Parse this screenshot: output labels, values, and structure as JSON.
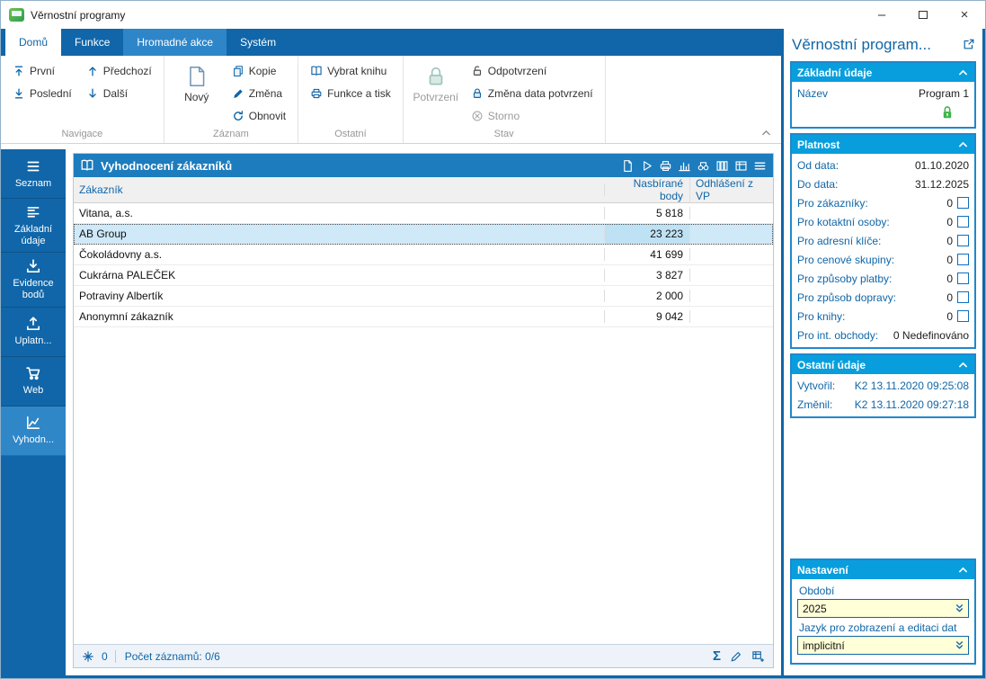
{
  "window": {
    "title": "Věrnostní programy",
    "minimize_glyph": "–",
    "close_glyph": "×"
  },
  "tabs": [
    {
      "label": "Domů",
      "active": true
    },
    {
      "label": "Funkce",
      "active": false
    },
    {
      "label": "Hromadné akce",
      "active": false,
      "highlighted": true
    },
    {
      "label": "Systém",
      "active": false
    }
  ],
  "ribbon": {
    "navigace": {
      "label": "Navigace",
      "first": "První",
      "prev": "Předchozí",
      "last": "Poslední",
      "next": "Další"
    },
    "zaznam": {
      "label": "Záznam",
      "new": "Nový",
      "copy": "Kopie",
      "change": "Změna",
      "refresh": "Obnovit"
    },
    "ostatni": {
      "label": "Ostatní",
      "select_book": "Vybrat knihu",
      "functions_print": "Funkce a tisk"
    },
    "stav": {
      "label": "Stav",
      "confirm": "Potvrzení",
      "unconfirm": "Odpotvrzení",
      "change_confirm_date": "Změna data potvrzení",
      "storno": "Storno"
    }
  },
  "sidebar": [
    {
      "label": "Seznam",
      "icon": "list-icon",
      "active": false
    },
    {
      "label": "Základní údaje",
      "icon": "detail-list-icon",
      "active": false
    },
    {
      "label": "Evidence bodů",
      "icon": "points-in-icon",
      "active": false
    },
    {
      "label": "Uplatn...",
      "icon": "points-out-icon",
      "active": false
    },
    {
      "label": "Web",
      "icon": "cart-icon",
      "active": false
    },
    {
      "label": "Vyhodn...",
      "icon": "line-chart-icon",
      "active": true
    }
  ],
  "main": {
    "title": "Vyhodnocení zákazníků",
    "columns": {
      "customer": "Zákazník",
      "points": "Nasbírané body",
      "optout": "Odhlášení z VP"
    },
    "selected_row_index": 1,
    "rows": [
      {
        "customer": "Vitana, a.s.",
        "points": "5 818",
        "optout": ""
      },
      {
        "customer": "AB Group",
        "points": "23 223",
        "optout": ""
      },
      {
        "customer": "Čokoládovny a.s.",
        "points": "41 699",
        "optout": ""
      },
      {
        "customer": "Cukrárna PALEČEK",
        "points": "3 827",
        "optout": ""
      },
      {
        "customer": "Potraviny Albertík",
        "points": "2 000",
        "optout": ""
      },
      {
        "customer": "Anonymní zákazník",
        "points": "9 042",
        "optout": ""
      }
    ],
    "status": {
      "flag_count": "0",
      "records": "Počet záznamů: 0/6",
      "sigma": "Σ"
    }
  },
  "panel": {
    "title": "Věrnostní program...",
    "zakladni": {
      "header": "Základní údaje",
      "nazev_label": "Název",
      "nazev_value": "Program 1"
    },
    "platnost": {
      "header": "Platnost",
      "rows": [
        {
          "label": "Od data:",
          "value": "01.10.2020",
          "checkbox": false
        },
        {
          "label": "Do data:",
          "value": "31.12.2025",
          "checkbox": false
        },
        {
          "label": "Pro zákazníky:",
          "value": "0",
          "checkbox": true
        },
        {
          "label": "Pro kotaktní osoby:",
          "value": "0",
          "checkbox": true
        },
        {
          "label": "Pro adresní klíče:",
          "value": "0",
          "checkbox": true
        },
        {
          "label": "Pro cenové skupiny:",
          "value": "0",
          "checkbox": true
        },
        {
          "label": "Pro způsoby platby:",
          "value": "0",
          "checkbox": true
        },
        {
          "label": "Pro způsob dopravy:",
          "value": "0",
          "checkbox": true
        },
        {
          "label": "Pro knihy:",
          "value": "0",
          "checkbox": true
        },
        {
          "label": "Pro int. obchody:",
          "value": "0 Nedefinováno",
          "checkbox": false
        }
      ]
    },
    "ostatni": {
      "header": "Ostatní údaje",
      "rows": [
        {
          "label": "Vytvořil:",
          "value": "K2 13.11.2020 09:25:08"
        },
        {
          "label": "Změnil:",
          "value": "K2 13.11.2020 09:27:18"
        }
      ]
    },
    "nastaveni": {
      "header": "Nastavení",
      "obdobi_label": "Období",
      "obdobi_value": "2025",
      "jazyk_label": "Jazyk pro zobrazení a editaci dat",
      "jazyk_value": "implicitní"
    }
  },
  "colors": {
    "dark_blue": "#1066a8",
    "tab_highlight": "#2e86c8",
    "panel_header_blue": "#1d7cbd",
    "section_header_blue": "#089edd",
    "selected_row": "#cfe9f9",
    "input_yellow": "#ffffd8",
    "green_lock": "#3db54a"
  },
  "icons": {
    "app-icon": "green-window-logo",
    "first-icon": "arrow-up-to-line",
    "prev-icon": "arrow-up",
    "last-icon": "arrow-down-to-line",
    "next-icon": "arrow-down",
    "new-record-icon": "blank-page",
    "copy-icon": "two-pages",
    "edit-icon": "pencil",
    "refresh-icon": "circular-arrow",
    "select-book-icon": "open-book",
    "print-icon": "printer",
    "confirm-lock-icon": "lock",
    "unconfirm-lock-icon": "open-lock",
    "change-date-lock-icon": "lock",
    "storno-icon": "crossed-circle",
    "panel-book-icon": "open-book",
    "run-icon": "play-triangle",
    "chart-icon": "bar-chart",
    "binoculars-icon": "binoculars",
    "columns-icon": "columns",
    "view-switch-icon": "grid",
    "menu-icon": "hamburger",
    "filter-flake-icon": "asterisk",
    "sum-icon": "sigma",
    "grid-copy-icon": "grid-plus",
    "external-link-icon": "box-arrow",
    "collapse-chevron-icon": "chevron-up",
    "dropdown-icon": "double-chevron-down",
    "green-lock-icon": "lock"
  }
}
